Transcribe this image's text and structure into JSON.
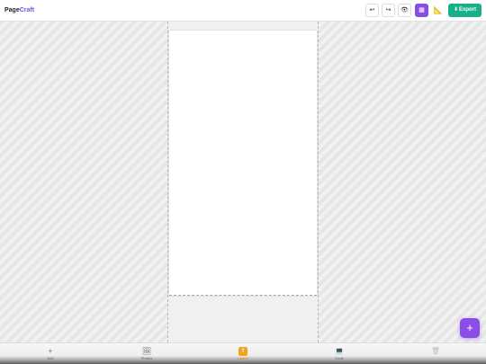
{
  "app": {
    "brand_part1": "Page",
    "brand_part2": "Craft"
  },
  "toolbar": {
    "undo_icon": "↩",
    "redo_icon": "↪",
    "preview_icon": "👁",
    "layers_icon": "▦",
    "ruler_icon": "📐",
    "export_label": "Export",
    "export_icon": "⬇"
  },
  "fab": {
    "icon": "+"
  },
  "bottombar": {
    "items": [
      {
        "icon": "+",
        "label": "Add"
      },
      {
        "icon": "🖼",
        "label": "Photos"
      },
      {
        "icon": "⇪",
        "label": "Layers"
      },
      {
        "icon": "💻",
        "label": "Code"
      },
      {
        "icon": "🗑",
        "label": "Delete"
      }
    ]
  },
  "colors": {
    "accent": "#8a4de6",
    "export": "#18b08a",
    "active_tab": "#f0a320"
  }
}
